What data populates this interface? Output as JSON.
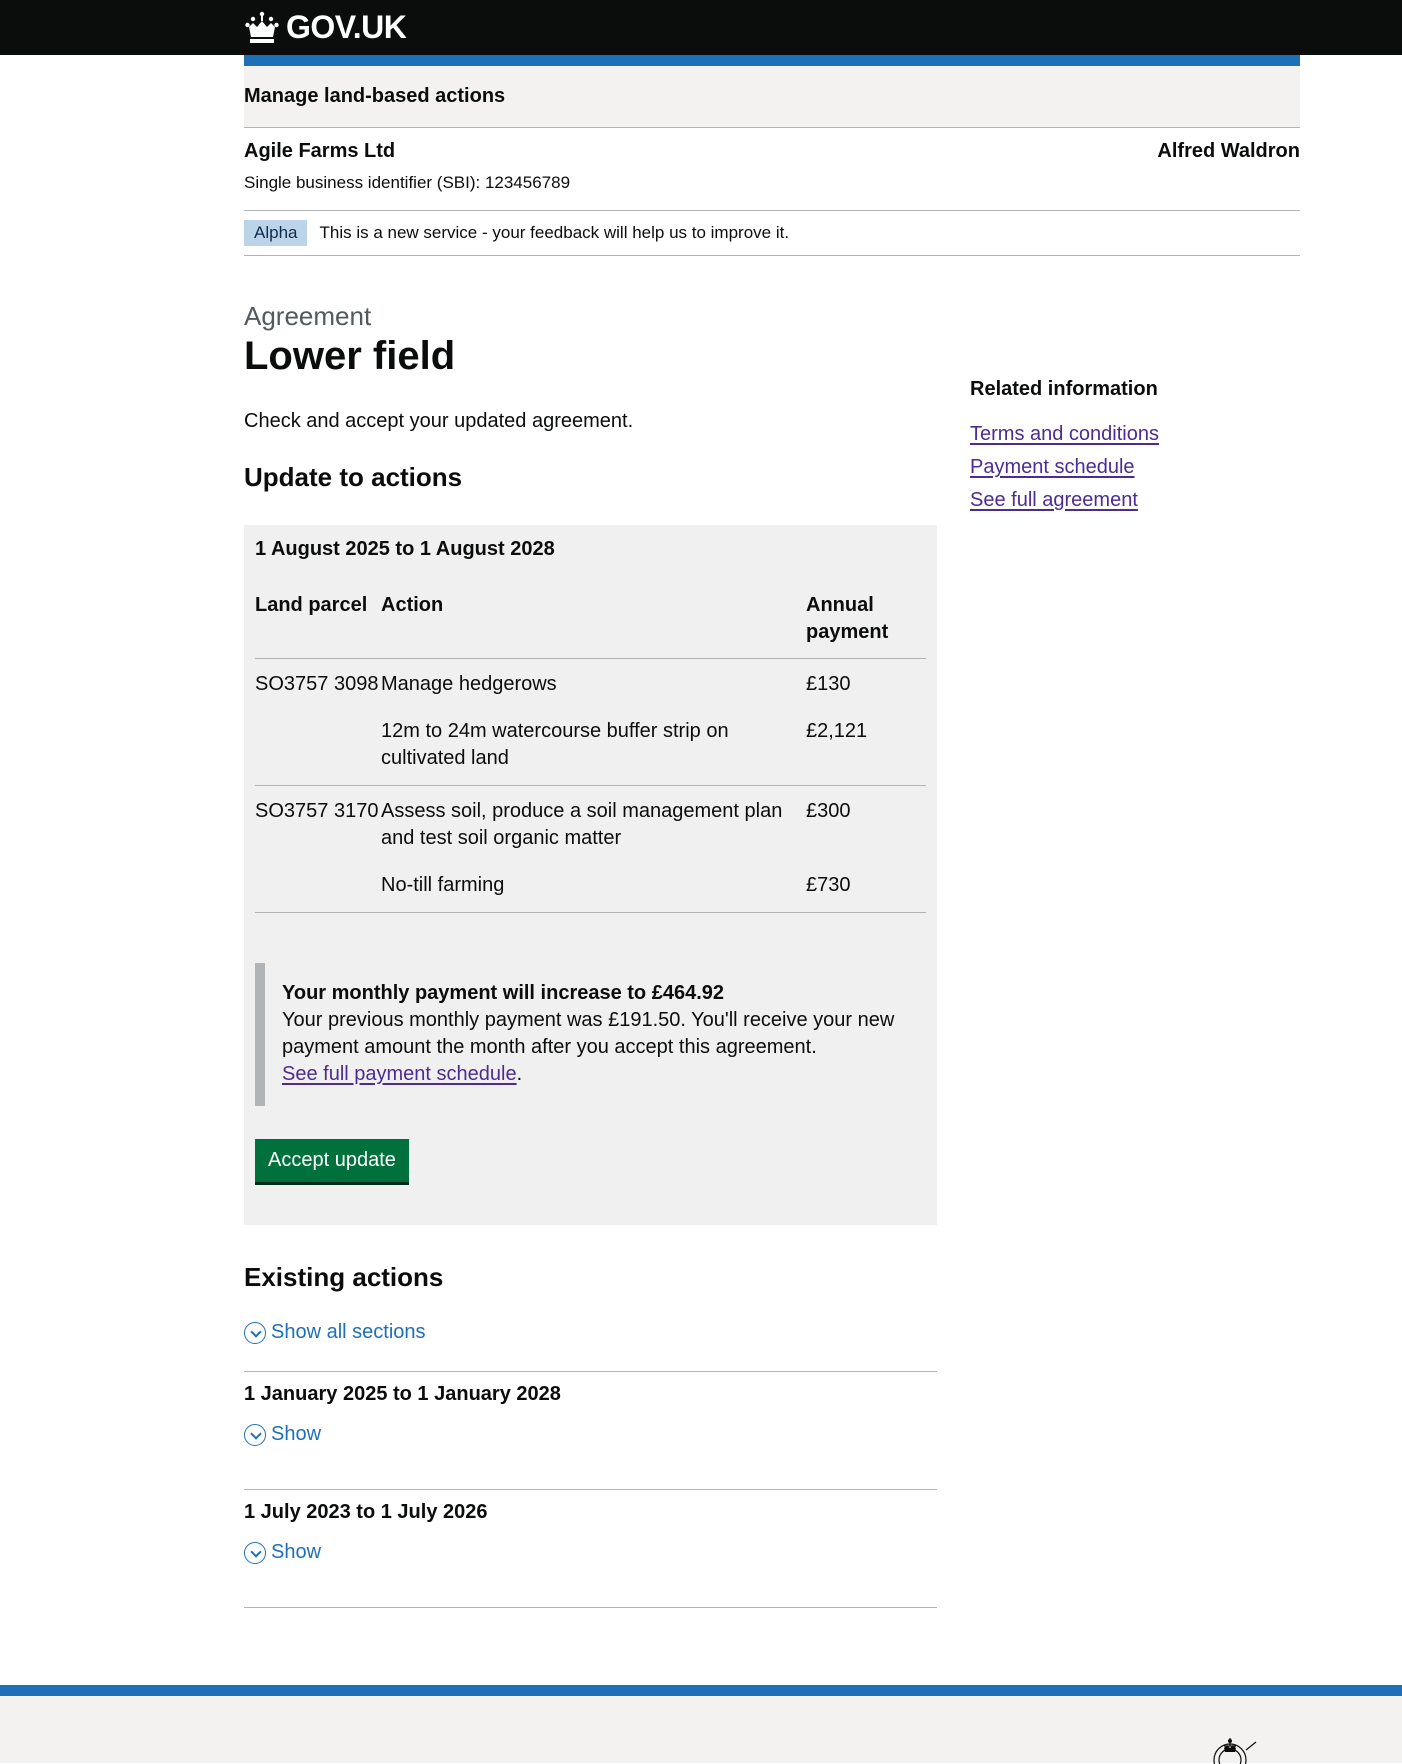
{
  "header": {
    "logo_text": "GOV.UK"
  },
  "service": {
    "name": "Manage land-based actions"
  },
  "org": {
    "name": "Agile Farms Ltd",
    "sbi": "Single business identifier (SBI): 123456789",
    "user": "Alfred Waldron"
  },
  "phase": {
    "tag": "Alpha",
    "text": "This is a new service - your feedback will help us to improve it."
  },
  "page": {
    "caption": "Agreement",
    "title": "Lower field",
    "intro": "Check and accept your updated agreement."
  },
  "update": {
    "heading": "Update to actions",
    "period": "1 August 2025 to 1 August 2028",
    "columns": {
      "parcel": "Land parcel",
      "action": "Action",
      "payment": "Annual payment"
    },
    "rows": [
      {
        "parcel": "SO3757 3098",
        "action": "Manage hedgerows",
        "payment": "£130"
      },
      {
        "parcel": "",
        "action": "12m to 24m watercourse buffer strip on cultivated land",
        "payment": "£2,121"
      },
      {
        "parcel": "SO3757 3170",
        "action": "Assess soil, produce a soil management plan and test soil organic matter",
        "payment": "£300"
      },
      {
        "parcel": "",
        "action": "No-till farming",
        "payment": "£730"
      }
    ],
    "inset": {
      "title": "Your monthly payment will increase to £464.92",
      "body": "Your previous monthly payment was £191.50. You'll receive your new payment amount the month after you accept this agreement.",
      "link": "See full payment schedule",
      "link_suffix": "."
    },
    "button": "Accept update"
  },
  "existing": {
    "heading": "Existing actions",
    "show_all": "Show all sections",
    "sections": [
      {
        "title": "1 January 2025 to 1 January 2028",
        "toggle": "Show"
      },
      {
        "title": "1 July 2023 to 1 July 2026",
        "toggle": "Show"
      }
    ]
  },
  "sidebar": {
    "title": "Related information",
    "links": [
      "Terms and conditions",
      "Payment schedule",
      "See full agreement"
    ]
  },
  "icons": {
    "logo": "crown-icon",
    "accordion": "chevron-down-circle-icon",
    "footer": "royal-crest-icon"
  },
  "colors": {
    "header_bg": "#0b0c0c",
    "brand_blue": "#1d70b8",
    "button_green": "#00703c",
    "link": "#4c2c92",
    "panel_bg": "#f0f0f0",
    "tag_bg": "#bbd4ea"
  }
}
